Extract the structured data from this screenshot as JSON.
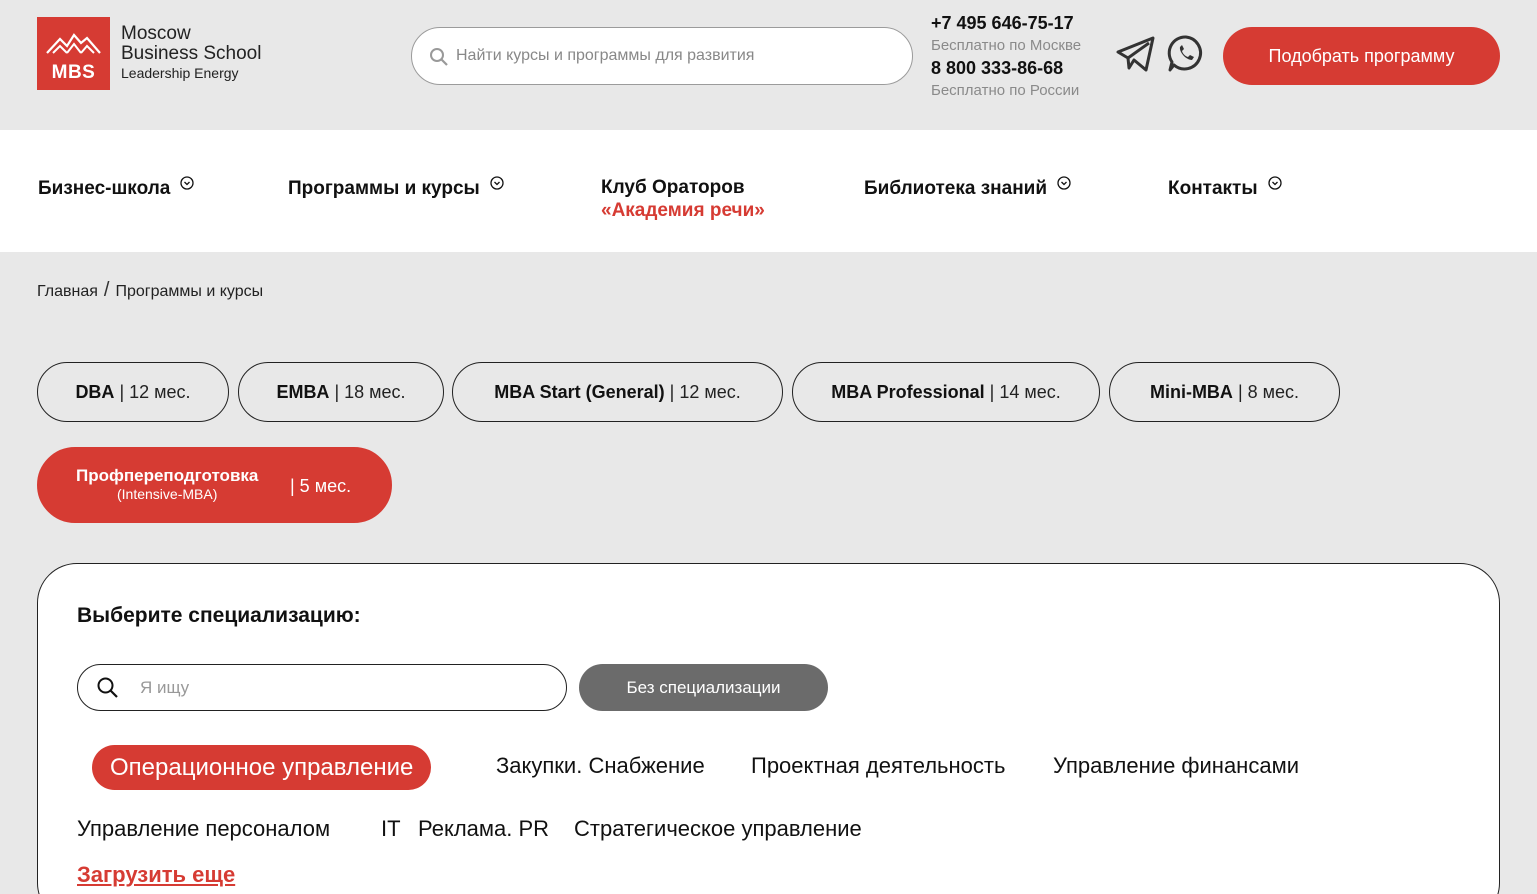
{
  "header": {
    "logo": {
      "abbr": "MBS",
      "line1": "Moscow",
      "line2": "Business School",
      "line3": "Leadership Energy"
    },
    "search_placeholder": "Найти курсы и программы для развития",
    "phones": [
      {
        "number": "+7 495 646-75-17",
        "note": "Бесплатно по Москве"
      },
      {
        "number": "8 800 333-86-68",
        "note": "Бесплатно по России"
      }
    ],
    "cta_label": "Подобрать программу",
    "accent": "#d63b33"
  },
  "nav": {
    "items": [
      {
        "label": "Бизнес-школа"
      },
      {
        "label": "Программы и курсы"
      },
      {
        "label": "Клуб Ораторов",
        "label_red": "«Академия речи»"
      },
      {
        "label": "Библиотека знаний"
      },
      {
        "label": "Контакты"
      }
    ]
  },
  "breadcrumb": {
    "home": "Главная",
    "separator": "/",
    "current": "Программы и курсы"
  },
  "programs": [
    {
      "name": "DBA",
      "duration": "| 12 мес."
    },
    {
      "name": "EMBA",
      "duration": "| 18 мес."
    },
    {
      "name": "MBA Start (General)",
      "duration": "| 12 мес."
    },
    {
      "name": "MBA Professional",
      "duration": "| 14 мес."
    },
    {
      "name": "Mini-MBA",
      "duration": "| 8 мес."
    },
    {
      "name": "Профпереподготовка",
      "subtitle": "(Intensive-MBA)",
      "duration": "| 5 мес.",
      "active": true
    }
  ],
  "specialization": {
    "title": "Выберите специализацию:",
    "search_placeholder": "Я ищу",
    "no_spec_label": "Без специализации",
    "chips": [
      "Операционное управление",
      "Закупки. Снабжение",
      "Проектная деятельность",
      "Управление финансами",
      "Управление персоналом",
      "IT",
      "Реклама. PR",
      "Стратегическое управление"
    ],
    "active_chip": "Операционное управление",
    "load_more": "Загрузить еще"
  }
}
